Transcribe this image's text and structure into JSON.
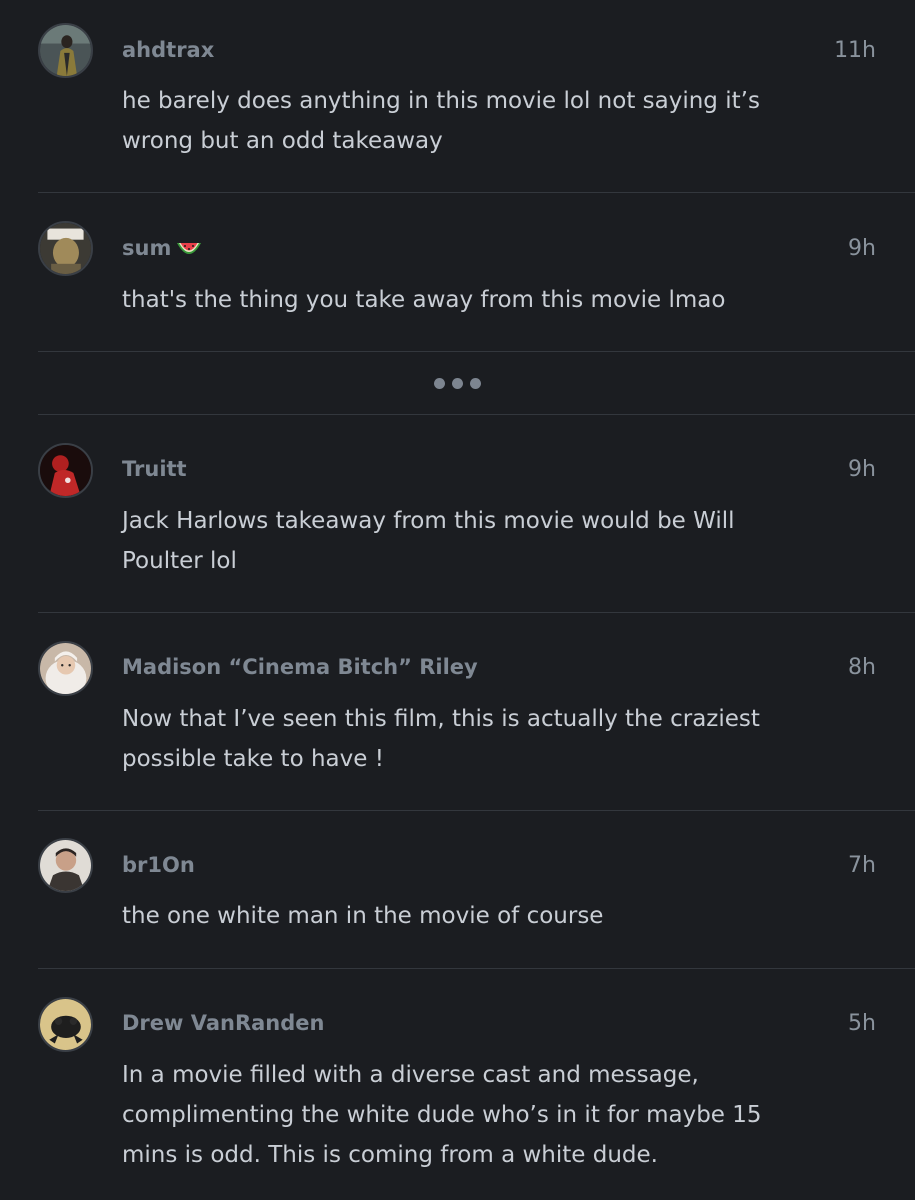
{
  "comments": [
    {
      "username": "ahdtrax",
      "time": "11h",
      "text": "he barely does anything in this movie lol not saying it’s wrong but an odd takeaway",
      "avatar_icon": "avatar-person-in-coat",
      "avatar_color": "#8a7a3a"
    },
    {
      "username": "sum",
      "username_emoji": "watermelon-icon",
      "time": "9h",
      "text": "that's the thing you take away from this movie lmao",
      "avatar_icon": "avatar-blonde-person",
      "avatar_color": "#a08a5a"
    },
    {
      "username": "Truitt",
      "time": "9h",
      "text": "Jack Harlows takeaway from this movie would be Will Poulter lol",
      "avatar_icon": "avatar-red-figure",
      "avatar_color": "#b02020"
    },
    {
      "username": "Madison “Cinema Bitch” Riley",
      "time": "8h",
      "text": "Now that I’ve seen this film, this is actually the craziest possible take to have !",
      "avatar_icon": "avatar-child-white-hood",
      "avatar_color": "#e8e2dc"
    },
    {
      "username": "br1On",
      "time": "7h",
      "text": "the one white man in the movie of course",
      "avatar_icon": "avatar-man-portrait",
      "avatar_color": "#3a3532"
    },
    {
      "username": "Drew VanRanden",
      "time": "5h",
      "text": "In a movie filled with a diverse cast and message, complimenting the white dude who’s in it for maybe 15 mins is odd. This is coming from a white dude.",
      "avatar_icon": "avatar-dark-creature",
      "avatar_color": "#d9c48a"
    }
  ],
  "more_replies_icon": "ellipsis-icon",
  "colors": {
    "background": "#1b1d21",
    "username": "#7f8893",
    "body_text": "#c9ced5",
    "divider": "#33373d"
  }
}
